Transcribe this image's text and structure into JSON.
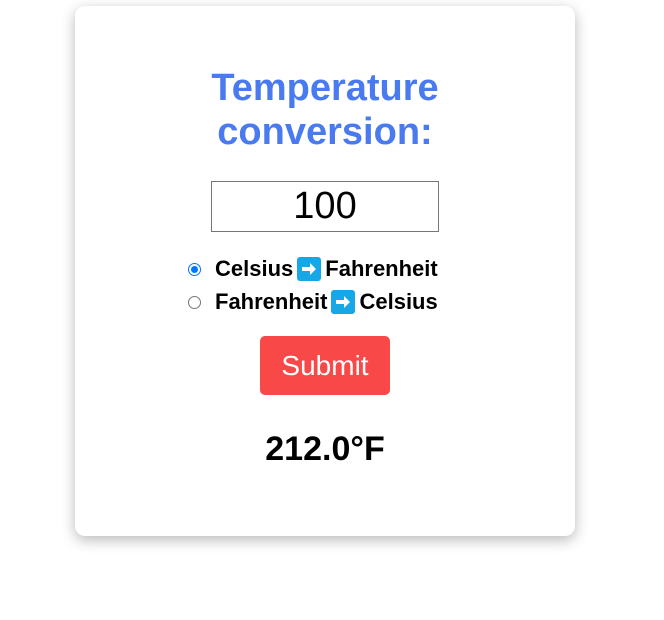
{
  "converter": {
    "title": "Temperature conversion:",
    "input_value": "100",
    "options": [
      {
        "from": "Celsius",
        "to": "Fahrenheit",
        "selected": true
      },
      {
        "from": "Fahrenheit",
        "to": "Celsius",
        "selected": false
      }
    ],
    "arrow_icon": "right-arrow-emoji-icon",
    "submit_label": "Submit",
    "result": "212.0°F"
  },
  "colors": {
    "title": "#4a7af0",
    "submit": "#f84848",
    "arrow_bg": "#17a6e6",
    "radio_checked": "#0075ff"
  }
}
